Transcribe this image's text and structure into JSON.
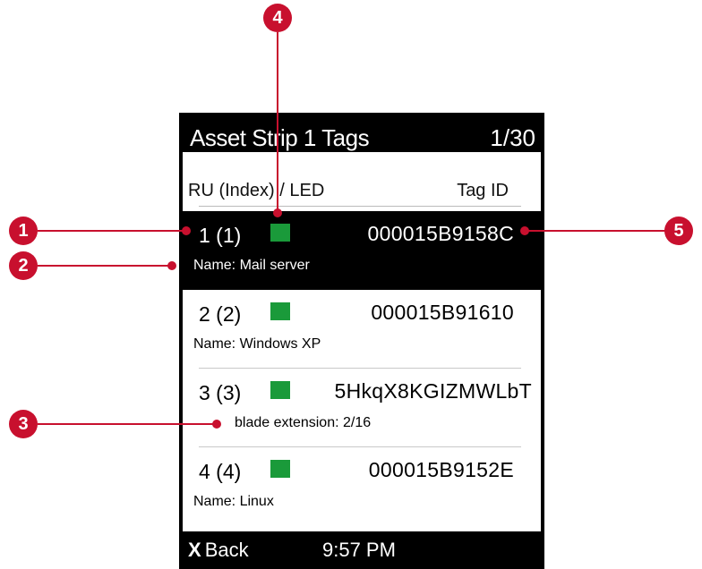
{
  "screen": {
    "title": "Asset Strip 1 Tags",
    "page_indicator": "1/30",
    "columns": {
      "left": "RU (Index) / LED",
      "right": "Tag ID"
    },
    "rows": [
      {
        "ru": "1 (1)",
        "tag": "000015B9158C",
        "name": "Name: Mail server",
        "selected": true
      },
      {
        "ru": "2 (2)",
        "tag": "000015B91610",
        "name": "Name: Windows XP",
        "selected": false
      },
      {
        "ru": "3 (3)",
        "tag": "5HkqX8KGIZMWLbT",
        "name": "blade extension: 2/16",
        "selected": false
      },
      {
        "ru": "4 (4)",
        "tag": "000015B9152E",
        "name": "Name: Linux",
        "selected": false
      }
    ],
    "led_color": "#1a9a3a",
    "footer": {
      "back_icon": "X",
      "back_label": "Back",
      "time": "9:57 PM"
    }
  },
  "callouts": {
    "c1": "1",
    "c2": "2",
    "c3": "3",
    "c4": "4",
    "c5": "5",
    "color": "#c8102e"
  }
}
